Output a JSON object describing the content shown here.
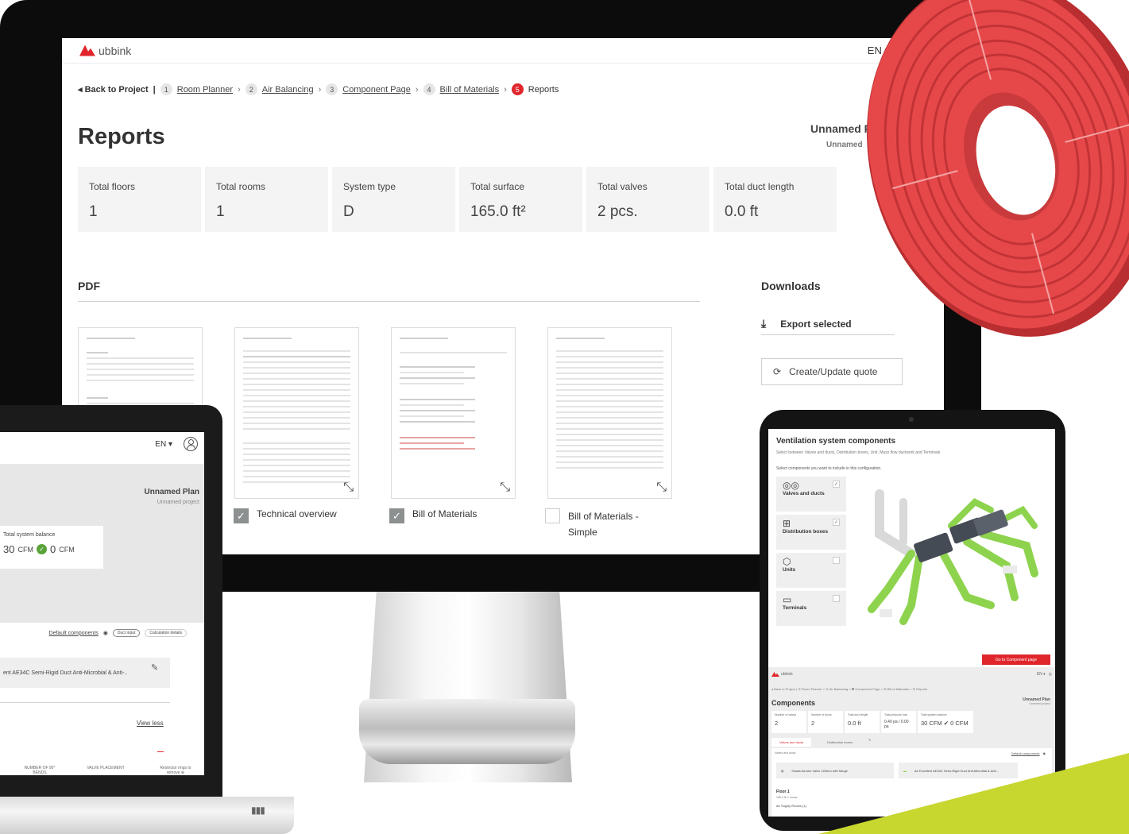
{
  "monitor": {
    "header": {
      "logo_text": "ubbink",
      "language": "EN ▾"
    },
    "breadcrumb": {
      "back": "◂ Back to Project",
      "divider": "|",
      "steps": [
        {
          "num": "1",
          "label": "Room Planner"
        },
        {
          "num": "2",
          "label": "Air Balancing"
        },
        {
          "num": "3",
          "label": "Component Page"
        },
        {
          "num": "4",
          "label": "Bill of Materials"
        },
        {
          "num": "5",
          "label": "Reports"
        }
      ]
    },
    "title": "Reports",
    "plan_name": "Unnamed P",
    "project_name": "Unnamed",
    "stats": [
      {
        "label": "Total floors",
        "value": "1"
      },
      {
        "label": "Total rooms",
        "value": "1"
      },
      {
        "label": "System type",
        "value": "D"
      },
      {
        "label": "Total surface",
        "value": "165.0 ft²"
      },
      {
        "label": "Total valves",
        "value": "2 pcs."
      },
      {
        "label": "Total duct length",
        "value": "0.0 ft"
      }
    ],
    "pdf_heading": "PDF",
    "downloads_heading": "Downloads",
    "export_label": "Export selected",
    "quote_label": "Create/Update quote",
    "reports": [
      {
        "label": "",
        "checked": false
      },
      {
        "label": "Technical overview",
        "checked": true
      },
      {
        "label": "Bill of Materials",
        "checked": true
      },
      {
        "label": "Bill of Materials - Simple",
        "checked": false
      }
    ]
  },
  "laptop": {
    "language": "EN ▾",
    "plan_name": "Unnamed Plan",
    "project_name": "Unnamed project",
    "balance_label": "Total system balance",
    "balance_left": "30",
    "balance_right": "0",
    "balance_unit": "CFM",
    "default_components": "Default components",
    "duct_input": "Duct input",
    "calc_details": "Calculation details",
    "component_text": "ent AE34C Semi-Rigid Duct Anti-Microbial & Anti-..",
    "view_less": "View less",
    "footer_cols": [
      "NUMBER OF 90° BENDS",
      "VALVE PLACEMENT",
      "Restrictor rings to remove ⊕"
    ]
  },
  "tablet": {
    "title": "Ventilation system components",
    "subtitle": "Select between Valves and ducts, Distribution boxes, Unit, Mass flow ductwork and Terminals",
    "select_text": "Select components you want to include in this configuration.",
    "cards": [
      {
        "label": "Valves and ducts",
        "icon": "◎◎",
        "checked": true
      },
      {
        "label": "Distribution boxes",
        "icon": "⊞",
        "checked": true
      },
      {
        "label": "Units",
        "icon": "⬡",
        "checked": false
      },
      {
        "label": "Terminals",
        "icon": "▭",
        "checked": false
      }
    ],
    "goto_label": "Go to Component page",
    "mini": {
      "logo": "ubbink",
      "language": "EN ▾",
      "crumbs": "◂ Back to Project | ① Room Planner > ② Air Balancing > ❸ Component Page > ④ Bill of Materials > ⑤ Reports",
      "title": "Components",
      "plan_name": "Unnamed Plan",
      "project_name": "Unnamed project",
      "stats": [
        {
          "label": "Number of valves",
          "value": "2"
        },
        {
          "label": "Number of ducts",
          "value": "2"
        },
        {
          "label": "Total duct length",
          "value": "0.0 ft"
        },
        {
          "label": "Total pressure loss",
          "value": "0.40 pa / 0.00 pa"
        },
        {
          "label": "Total system balance",
          "value": "30 CFM ✔ 0 CFM"
        }
      ],
      "tabs": [
        "Valves and ducts",
        "Distribution boxes"
      ],
      "panel_label": "Valves and ducts",
      "default_components": "Default components",
      "item1": "Haaks Aeroko Valve 125mm with flange",
      "item2": "Air Excellent AE34C Semi-Rigid Duct Anti-Microbial & Anti...",
      "floor": "Floor 1",
      "floor_sub": "165.0 ft²   1 rooms",
      "air_rooms": "Air Supply Rooms (1)"
    }
  }
}
